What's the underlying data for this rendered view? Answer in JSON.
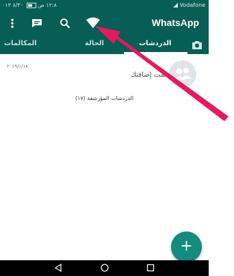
{
  "status_bar": {
    "carrier": "Vodafone",
    "time": "١٢:٨ ص",
    "left_info": "٨/٣٠ ٠١٣"
  },
  "toolbar": {
    "app_title": "WhatsApp",
    "icons": [
      "more-vert-icon",
      "new-chat-icon",
      "search-icon",
      "wifi-icon"
    ]
  },
  "tabs": [
    {
      "label": "الدردشات",
      "active": true
    },
    {
      "label": "الحالة",
      "active": false
    },
    {
      "label": "المكالمات",
      "active": false
    }
  ],
  "chat": {
    "date": "٢٠١٩/١/١٨",
    "subtitle": "تمت إضافتك"
  },
  "archived_label": "الدردشات المؤرشفة (١٧)",
  "colors": {
    "header": "#075e54",
    "fab": "#128c7e",
    "annotation_arrow": "#e8185e"
  }
}
